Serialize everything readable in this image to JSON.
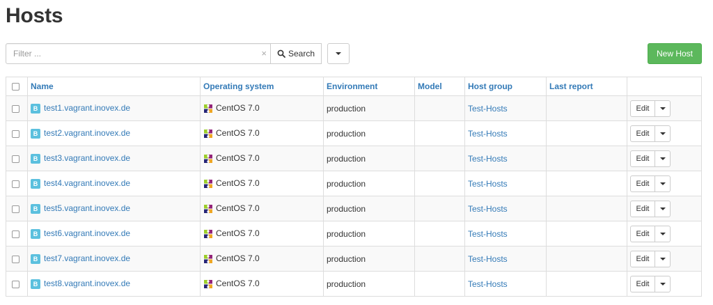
{
  "page": {
    "title": "Hosts"
  },
  "toolbar": {
    "filter_placeholder": "Filter ...",
    "filter_value": "",
    "clear_label": "×",
    "search_label": "Search",
    "new_host_label": "New Host"
  },
  "table": {
    "columns": [
      "Name",
      "Operating system",
      "Environment",
      "Model",
      "Host group",
      "Last report",
      ""
    ],
    "rows": [
      {
        "name": "test1.vagrant.inovex.de",
        "os": "CentOS 7.0",
        "environment": "production",
        "model": "",
        "host_group": "Test-Hosts",
        "last_report": "",
        "action": "Edit"
      },
      {
        "name": "test2.vagrant.inovex.de",
        "os": "CentOS 7.0",
        "environment": "production",
        "model": "",
        "host_group": "Test-Hosts",
        "last_report": "",
        "action": "Edit"
      },
      {
        "name": "test3.vagrant.inovex.de",
        "os": "CentOS 7.0",
        "environment": "production",
        "model": "",
        "host_group": "Test-Hosts",
        "last_report": "",
        "action": "Edit"
      },
      {
        "name": "test4.vagrant.inovex.de",
        "os": "CentOS 7.0",
        "environment": "production",
        "model": "",
        "host_group": "Test-Hosts",
        "last_report": "",
        "action": "Edit"
      },
      {
        "name": "test5.vagrant.inovex.de",
        "os": "CentOS 7.0",
        "environment": "production",
        "model": "",
        "host_group": "Test-Hosts",
        "last_report": "",
        "action": "Edit"
      },
      {
        "name": "test6.vagrant.inovex.de",
        "os": "CentOS 7.0",
        "environment": "production",
        "model": "",
        "host_group": "Test-Hosts",
        "last_report": "",
        "action": "Edit"
      },
      {
        "name": "test7.vagrant.inovex.de",
        "os": "CentOS 7.0",
        "environment": "production",
        "model": "",
        "host_group": "Test-Hosts",
        "last_report": "",
        "action": "Edit"
      },
      {
        "name": "test8.vagrant.inovex.de",
        "os": "CentOS 7.0",
        "environment": "production",
        "model": "",
        "host_group": "Test-Hosts",
        "last_report": "",
        "action": "Edit"
      }
    ],
    "badge_letter": "B"
  },
  "icons": {
    "search": "magnifier-icon",
    "host_badge": "host-status-icon",
    "os": "centos-logo-icon",
    "caret": "chevron-down-icon"
  },
  "colors": {
    "link": "#337ab7",
    "primary_button": "#5cb85c",
    "badge": "#5bc0de"
  }
}
